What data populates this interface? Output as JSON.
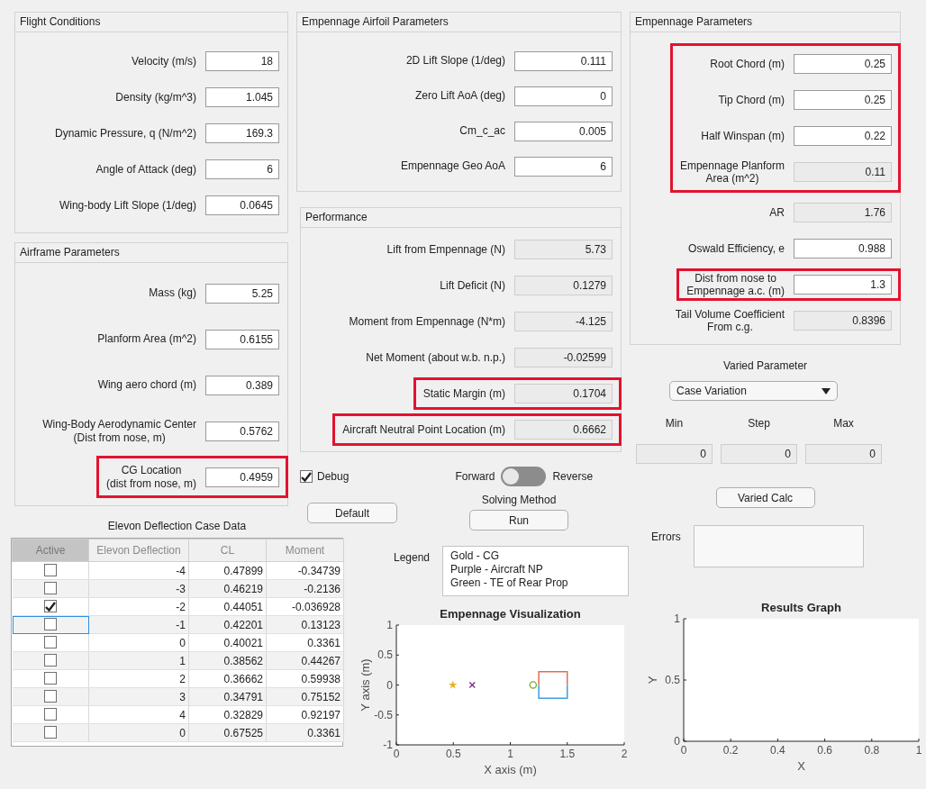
{
  "flight_conditions": {
    "title": "Flight Conditions",
    "groups": [
      {
        "highlighted": false,
        "fields": [
          {
            "label": "Velocity (m/s)",
            "value": "18",
            "editable": true
          },
          {
            "label": "Density (kg/m^3)",
            "value": "1.045",
            "editable": true
          },
          {
            "label": "Dynamic Pressure, q (N/m^2)",
            "value": "169.3",
            "editable": true
          },
          {
            "label": "Angle of Attack (deg)",
            "value": "6",
            "editable": true
          },
          {
            "label": "Wing-body Lift Slope (1/deg)",
            "value": "0.0645",
            "editable": true
          }
        ]
      }
    ]
  },
  "airframe_parameters": {
    "title": "Airframe Parameters",
    "groups": [
      {
        "highlighted": false,
        "fields": [
          {
            "label": "Mass (kg)",
            "value": "5.25",
            "editable": true
          },
          {
            "label": "Planform Area (m^2)",
            "value": "0.6155",
            "editable": true
          },
          {
            "label": "Wing aero chord (m)",
            "value": "0.389",
            "editable": true
          },
          {
            "label": "Wing-Body Aerodynamic Center\n(Dist from nose, m)",
            "value": "0.5762",
            "editable": true
          }
        ]
      },
      {
        "highlighted": true,
        "fields": [
          {
            "label": "CG Location\n(dist from nose, m)",
            "value": "0.4959",
            "editable": true
          }
        ]
      }
    ]
  },
  "empennage_airfoil_parameters": {
    "title": "Empennage Airfoil Parameters",
    "groups": [
      {
        "highlighted": false,
        "fields": [
          {
            "label": "2D Lift Slope (1/deg)",
            "value": "0.111",
            "editable": true
          },
          {
            "label": "Zero Lift AoA (deg)",
            "value": "0",
            "editable": true
          },
          {
            "label": "Cm_c_ac",
            "value": "0.005",
            "editable": true
          },
          {
            "label": "Empennage Geo AoA",
            "value": "6",
            "editable": true
          }
        ]
      }
    ]
  },
  "performance": {
    "title": "Performance",
    "groups": [
      {
        "highlighted": false,
        "fields": [
          {
            "label": "Lift from Empennage (N)",
            "value": "5.73",
            "editable": false
          },
          {
            "label": "Lift Deficit (N)",
            "value": "0.1279",
            "editable": false
          },
          {
            "label": "Moment from Empennage (N*m)",
            "value": "-4.125",
            "editable": false
          },
          {
            "label": "Net Moment (about w.b. n.p.)",
            "value": "-0.02599",
            "editable": false
          }
        ]
      },
      {
        "highlighted": true,
        "fields": [
          {
            "label": "Static Margin (m)",
            "value": "0.1704",
            "editable": false
          }
        ]
      },
      {
        "highlighted": true,
        "fields": [
          {
            "label": "Aircraft Neutral Point Location (m)",
            "value": "0.6662",
            "editable": false
          }
        ]
      }
    ]
  },
  "empennage_parameters": {
    "title": "Empennage Parameters",
    "groups": [
      {
        "highlighted": true,
        "fields": [
          {
            "label": "Root Chord (m)",
            "value": "0.25",
            "editable": true
          },
          {
            "label": "Tip Chord (m)",
            "value": "0.25",
            "editable": true
          },
          {
            "label": "Half Winspan (m)",
            "value": "0.22",
            "editable": true
          },
          {
            "label": "Empennage Planform\nArea (m^2)",
            "value": "0.11",
            "editable": false
          }
        ]
      },
      {
        "highlighted": false,
        "fields": [
          {
            "label": "AR",
            "value": "1.76",
            "editable": false
          },
          {
            "label": "Oswald Efficiency, e",
            "value": "0.988",
            "editable": true
          }
        ]
      },
      {
        "highlighted": true,
        "fields": [
          {
            "label": "Dist from nose to\nEmpennage a.c. (m)",
            "value": "1.3",
            "editable": true
          }
        ]
      },
      {
        "highlighted": false,
        "fields": [
          {
            "label": "Tail Volume Coefficient\nFrom c.g.",
            "value": "0.8396",
            "editable": false
          }
        ]
      }
    ]
  },
  "debug": {
    "label": "Debug",
    "checked": true
  },
  "direction_switch": {
    "left_label": "Forward",
    "right_label": "Reverse",
    "on": false
  },
  "default_button": "Default",
  "solving_method": {
    "label": "Solving Method",
    "button": "Run"
  },
  "varied_parameter": {
    "title": "Varied Parameter",
    "dropdown": "Case Variation",
    "range": [
      {
        "label": "Min",
        "value": "0",
        "editable": false
      },
      {
        "label": "Step",
        "value": "0",
        "editable": false
      },
      {
        "label": "Max",
        "value": "0",
        "editable": false
      }
    ],
    "button": "Varied Calc"
  },
  "elevon_table": {
    "title": "Elevon Deflection Case Data",
    "columns": [
      {
        "label": "Active",
        "kind": "checkbox"
      },
      {
        "label": "Elevon Deflection",
        "kind": "number"
      },
      {
        "label": "CL",
        "kind": "number"
      },
      {
        "label": "Moment",
        "kind": "number"
      }
    ],
    "rows": [
      {
        "active": false,
        "focused": false,
        "cells": [
          "",
          "-4",
          "0.47899",
          "-0.34739"
        ]
      },
      {
        "active": false,
        "focused": false,
        "cells": [
          "",
          "-3",
          "0.46219",
          "-0.2136"
        ]
      },
      {
        "active": true,
        "focused": false,
        "cells": [
          "",
          "-2",
          "0.44051",
          "-0.036928"
        ]
      },
      {
        "active": false,
        "focused": true,
        "cells": [
          "",
          "-1",
          "0.42201",
          "0.13123"
        ]
      },
      {
        "active": false,
        "focused": false,
        "cells": [
          "",
          "0",
          "0.40021",
          "0.3361"
        ]
      },
      {
        "active": false,
        "focused": false,
        "cells": [
          "",
          "1",
          "0.38562",
          "0.44267"
        ]
      },
      {
        "active": false,
        "focused": false,
        "cells": [
          "",
          "2",
          "0.36662",
          "0.59938"
        ]
      },
      {
        "active": false,
        "focused": false,
        "cells": [
          "",
          "3",
          "0.34791",
          "0.75152"
        ]
      },
      {
        "active": false,
        "focused": false,
        "cells": [
          "",
          "4",
          "0.32829",
          "0.92197"
        ]
      },
      {
        "active": false,
        "focused": false,
        "cells": [
          "",
          "0",
          "0.67525",
          "0.3361"
        ]
      }
    ]
  },
  "legend": {
    "label": "Legend",
    "entries": [
      "Gold - CG",
      "Purple - Aircraft NP",
      "Green - TE of Rear Prop"
    ]
  },
  "errors": {
    "label": "Errors"
  },
  "empennage_visualization": {
    "chart_data": {
      "type": "line",
      "title": "Empennage Visualization",
      "xlabel": "X axis (m)",
      "ylabel": "Y axis (m)",
      "xlim": [
        0,
        2
      ],
      "ylim": [
        -1,
        1
      ],
      "xticks": [
        0,
        0.5,
        1,
        1.5,
        2
      ],
      "yticks": [
        -1,
        -0.5,
        0,
        0.5,
        1
      ],
      "series": [
        {
          "marker": "star",
          "color": "#edb120",
          "x": [
            0.4959
          ],
          "values": [
            0
          ]
        },
        {
          "marker": "cross",
          "color": "#7e2f8e",
          "x": [
            0.6662
          ],
          "values": [
            0
          ]
        },
        {
          "marker": "circle",
          "color": "#77ac30",
          "x": [
            1.2
          ],
          "values": [
            0
          ]
        },
        {
          "color": "#e07050",
          "x": [
            1.25,
            1.25,
            1.5,
            1.5
          ],
          "values": [
            0,
            0.22,
            0.22,
            0
          ]
        },
        {
          "color": "#3f9ee0",
          "x": [
            1.25,
            1.25,
            1.5,
            1.5
          ],
          "values": [
            0,
            -0.22,
            -0.22,
            0
          ]
        }
      ]
    }
  },
  "results_graph": {
    "chart_data": {
      "type": "line",
      "title": "Results Graph",
      "xlabel": "X",
      "ylabel": "Y",
      "xlim": [
        0,
        1
      ],
      "ylim": [
        0,
        1
      ],
      "xticks": [
        0,
        0.2,
        0.4,
        0.6,
        0.8,
        1
      ],
      "yticks": [
        0,
        0.5,
        1
      ]
    }
  }
}
